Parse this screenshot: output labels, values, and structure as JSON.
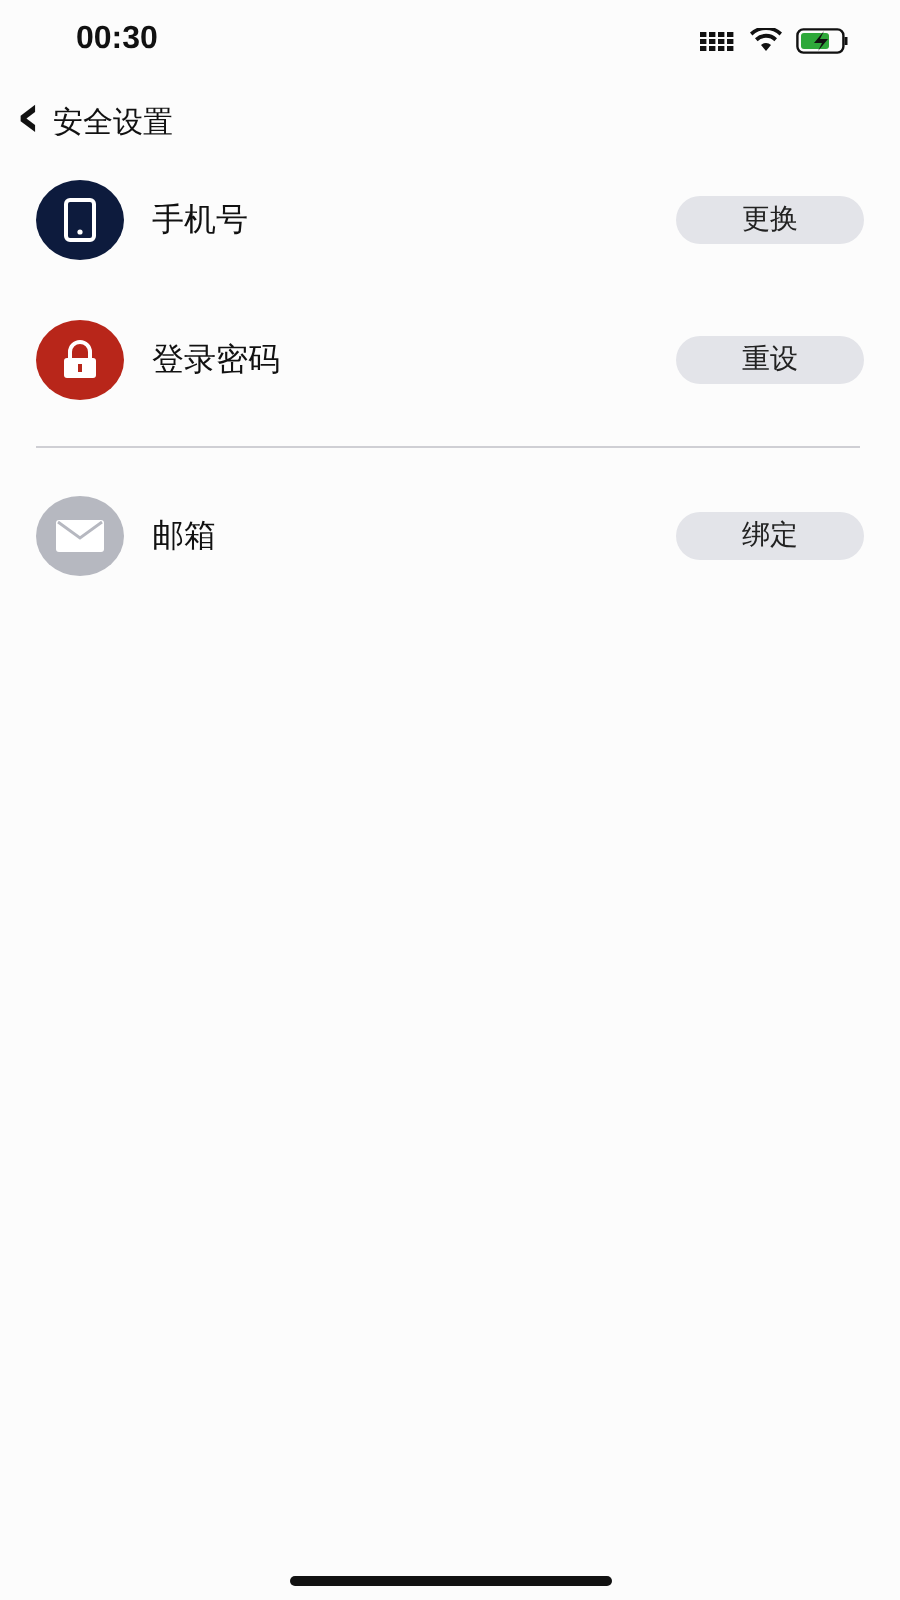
{
  "status_bar": {
    "time": "00:30"
  },
  "nav": {
    "back_icon": "‹",
    "title": "安全设置"
  },
  "sections": [
    {
      "items": [
        {
          "kind": "phone",
          "color": "#0d1b3d",
          "label": "手机号",
          "action": "更换"
        },
        {
          "kind": "lock",
          "color": "#b8261a",
          "label": "登录密码",
          "action": "重设"
        }
      ]
    },
    {
      "items": [
        {
          "kind": "mail",
          "color": "#b6b8c0",
          "label": "邮箱",
          "action": "绑定"
        }
      ]
    }
  ]
}
